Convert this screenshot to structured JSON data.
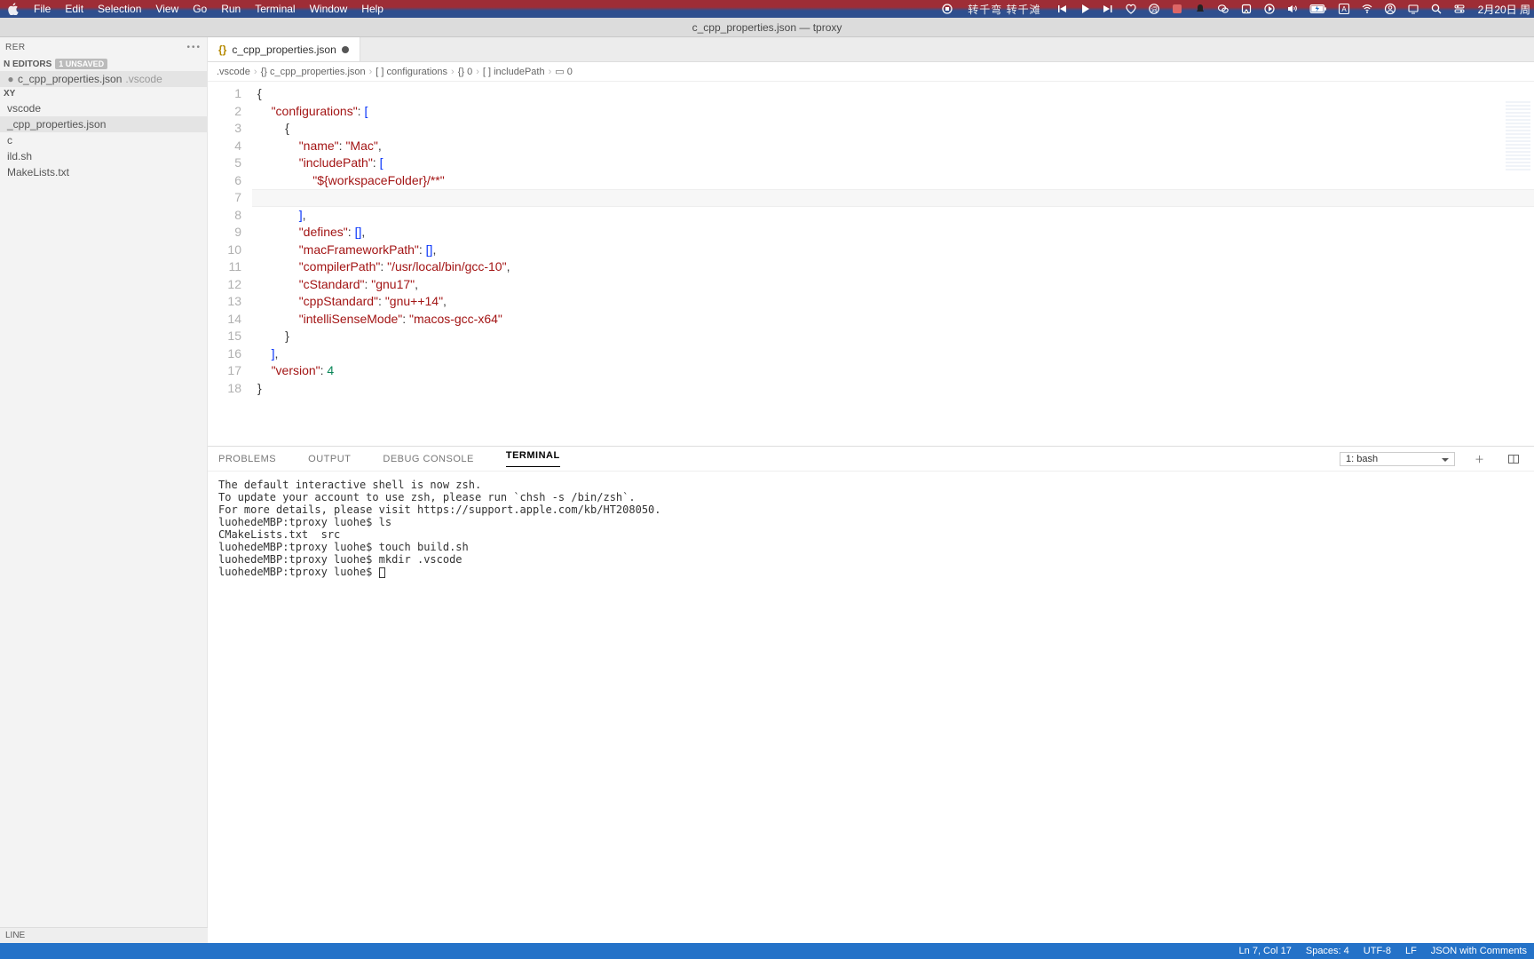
{
  "menubar": {
    "items": [
      "File",
      "Edit",
      "Selection",
      "View",
      "Go",
      "Run",
      "Terminal",
      "Window",
      "Help"
    ],
    "music_title": "转千弯 转千滩",
    "clock": "2月20日 周"
  },
  "titlebar": {
    "text": "c_cpp_properties.json — tproxy"
  },
  "explorer": {
    "title": "RER",
    "open_editors_label": "N EDITORS",
    "open_editors_badge": "1 UNSAVED",
    "open_editor_file": "c_cpp_properties.json",
    "open_editor_dir": ".vscode",
    "proj_label": "XY",
    "tree": [
      {
        "name": "vscode",
        "kind": "folder"
      },
      {
        "name": "_cpp_properties.json",
        "kind": "file",
        "selected": true
      },
      {
        "name": "c",
        "kind": "folder"
      },
      {
        "name": "ild.sh",
        "kind": "file"
      },
      {
        "name": "MakeLists.txt",
        "kind": "file"
      }
    ],
    "outline_label": "LINE"
  },
  "tab": {
    "icon": "{}",
    "title": "c_cpp_properties.json",
    "dirty": true
  },
  "breadcrumb": [
    ".vscode",
    "{} c_cpp_properties.json",
    "[ ] configurations",
    "{} 0",
    "[ ] includePath",
    "▭ 0"
  ],
  "code": {
    "line_count": 18,
    "cursor_line": 7,
    "lines": [
      [
        [
          "pun",
          "{"
        ]
      ],
      [
        [
          "ind",
          "    "
        ],
        [
          "key",
          "\"configurations\""
        ],
        [
          "pun",
          ": "
        ],
        [
          "br",
          "["
        ]
      ],
      [
        [
          "ind",
          "        "
        ],
        [
          "pun",
          "{"
        ]
      ],
      [
        [
          "ind",
          "            "
        ],
        [
          "key",
          "\"name\""
        ],
        [
          "pun",
          ": "
        ],
        [
          "str",
          "\"Mac\""
        ],
        [
          "pun",
          ","
        ]
      ],
      [
        [
          "ind",
          "            "
        ],
        [
          "key",
          "\"includePath\""
        ],
        [
          "pun",
          ": "
        ],
        [
          "br",
          "["
        ]
      ],
      [
        [
          "ind",
          "                "
        ],
        [
          "str",
          "\"${workspaceFolder}/**\""
        ]
      ],
      [
        [
          "ind",
          "                "
        ]
      ],
      [
        [
          "ind",
          "            "
        ],
        [
          "br",
          "]"
        ],
        [
          "pun",
          ","
        ]
      ],
      [
        [
          "ind",
          "            "
        ],
        [
          "key",
          "\"defines\""
        ],
        [
          "pun",
          ": "
        ],
        [
          "br",
          "[]"
        ],
        [
          "pun",
          ","
        ]
      ],
      [
        [
          "ind",
          "            "
        ],
        [
          "key",
          "\"macFrameworkPath\""
        ],
        [
          "pun",
          ": "
        ],
        [
          "br",
          "[]"
        ],
        [
          "pun",
          ","
        ]
      ],
      [
        [
          "ind",
          "            "
        ],
        [
          "key",
          "\"compilerPath\""
        ],
        [
          "pun",
          ": "
        ],
        [
          "str",
          "\"/usr/local/bin/gcc-10\""
        ],
        [
          "pun",
          ","
        ]
      ],
      [
        [
          "ind",
          "            "
        ],
        [
          "key",
          "\"cStandard\""
        ],
        [
          "pun",
          ": "
        ],
        [
          "str",
          "\"gnu17\""
        ],
        [
          "pun",
          ","
        ]
      ],
      [
        [
          "ind",
          "            "
        ],
        [
          "key",
          "\"cppStandard\""
        ],
        [
          "pun",
          ": "
        ],
        [
          "str",
          "\"gnu++14\""
        ],
        [
          "pun",
          ","
        ]
      ],
      [
        [
          "ind",
          "            "
        ],
        [
          "key",
          "\"intelliSenseMode\""
        ],
        [
          "pun",
          ": "
        ],
        [
          "str",
          "\"macos-gcc-x64\""
        ]
      ],
      [
        [
          "ind",
          "        "
        ],
        [
          "pun",
          "}"
        ]
      ],
      [
        [
          "ind",
          "    "
        ],
        [
          "br",
          "]"
        ],
        [
          "pun",
          ","
        ]
      ],
      [
        [
          "ind",
          "    "
        ],
        [
          "key",
          "\"version\""
        ],
        [
          "pun",
          ": "
        ],
        [
          "num",
          "4"
        ]
      ],
      [
        [
          "pun",
          "}"
        ]
      ]
    ]
  },
  "panel": {
    "tabs": [
      "PROBLEMS",
      "OUTPUT",
      "DEBUG CONSOLE",
      "TERMINAL"
    ],
    "active_tab": "TERMINAL",
    "term_selector": "1: bash",
    "terminal_lines": [
      "The default interactive shell is now zsh.",
      "To update your account to use zsh, please run `chsh -s /bin/zsh`.",
      "For more details, please visit https://support.apple.com/kb/HT208050.",
      "luohedeMBP:tproxy luohe$ ls",
      "CMakeLists.txt  src",
      "luohedeMBP:tproxy luohe$ touch build.sh",
      "luohedeMBP:tproxy luohe$ mkdir .vscode",
      "luohedeMBP:tproxy luohe$ "
    ]
  },
  "statusbar": {
    "line_col": "Ln 7, Col 17",
    "spaces": "Spaces: 4",
    "encoding": "UTF-8",
    "eol": "LF",
    "lang": "JSON with Comments"
  }
}
